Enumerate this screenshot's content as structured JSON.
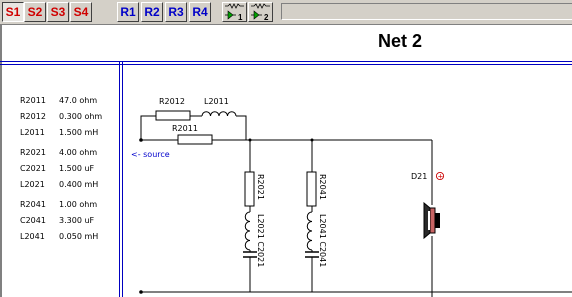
{
  "toolbar": {
    "s_buttons": [
      "S1",
      "S2",
      "S3",
      "S4"
    ],
    "r_buttons": [
      "R1",
      "R2",
      "R3",
      "R4"
    ],
    "icon_buttons": [
      {
        "name": "driver-1-icon",
        "sub": "1"
      },
      {
        "name": "driver-2-icon",
        "sub": "2"
      }
    ]
  },
  "net_title": "Net 2",
  "components": [
    {
      "name": "R2011",
      "value": "47.0 ohm"
    },
    {
      "name": "R2012",
      "value": "0.300 ohm"
    },
    {
      "name": "L2011",
      "value": "1.500 mH"
    },
    {
      "name": "R2021",
      "value": "4.00 ohm"
    },
    {
      "name": "C2021",
      "value": "1.500 uF"
    },
    {
      "name": "L2021",
      "value": "0.400 mH"
    },
    {
      "name": "R2041",
      "value": "1.00 ohm"
    },
    {
      "name": "C2041",
      "value": "3.300 uF"
    },
    {
      "name": "L2041",
      "value": "0.050 mH"
    }
  ],
  "schematic": {
    "source_label": "<- source",
    "r2012": "R2012",
    "l2011": "L2011",
    "r2011": "R2011",
    "r2021": "R2021",
    "l2021_c2021": "L2021 C2021",
    "r2041": "R2041",
    "l2041_c2041": "L2041 C2041",
    "driver": "D21",
    "polarity": "+"
  },
  "colors": {
    "s_buttons": "#d00000",
    "r_buttons": "#0000c8",
    "border_lines": "#0000c0",
    "polarity_mark": "#cc0000"
  }
}
